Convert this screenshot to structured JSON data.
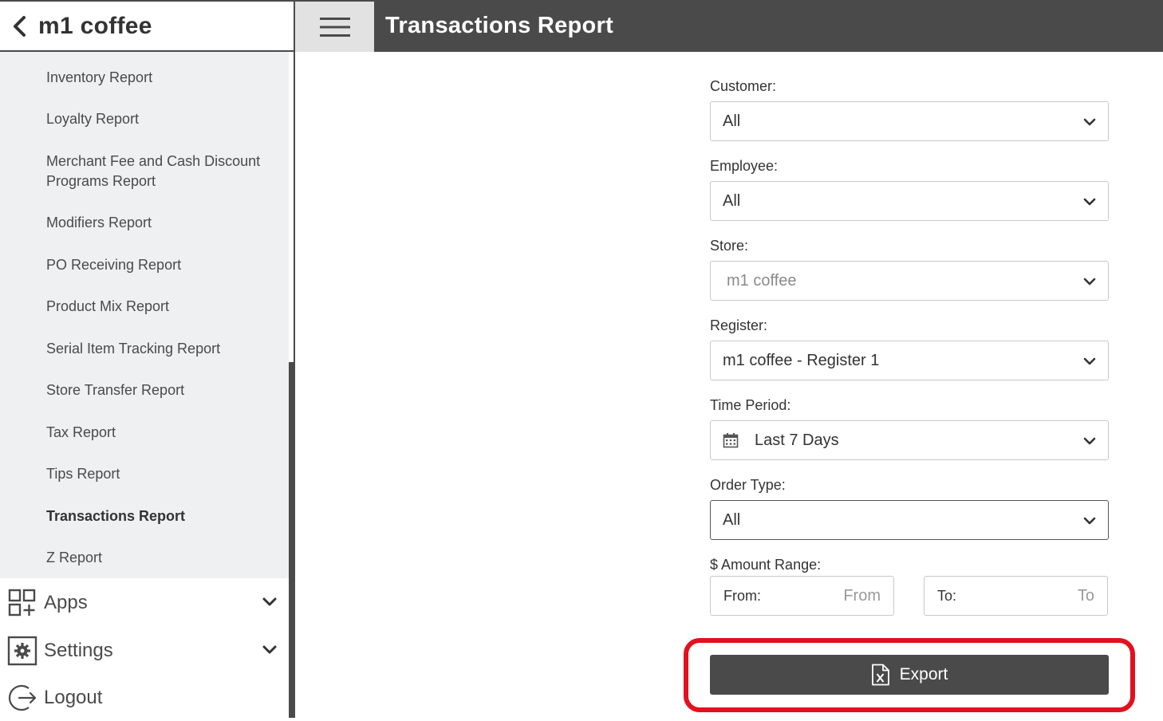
{
  "sidebar": {
    "brand": "m1 coffee",
    "items": [
      {
        "label": "Inventory Report"
      },
      {
        "label": "Loyalty Report"
      },
      {
        "label": "Merchant Fee and Cash Discount Programs Report"
      },
      {
        "label": "Modifiers Report"
      },
      {
        "label": "PO Receiving Report"
      },
      {
        "label": "Product Mix Report"
      },
      {
        "label": "Serial Item Tracking Report"
      },
      {
        "label": "Store Transfer Report"
      },
      {
        "label": "Tax Report"
      },
      {
        "label": "Tips Report"
      },
      {
        "label": "Transactions Report",
        "active": true
      },
      {
        "label": "Z Report"
      }
    ],
    "apps_label": "Apps",
    "settings_label": "Settings",
    "logout_label": "Logout"
  },
  "header": {
    "title": "Transactions Report"
  },
  "form": {
    "customer": {
      "label": "Customer:",
      "value": "All"
    },
    "employee": {
      "label": "Employee:",
      "value": "All"
    },
    "store": {
      "label": "Store:",
      "value": "m1 coffee"
    },
    "register": {
      "label": "Register:",
      "value": "m1 coffee - Register 1"
    },
    "time_period": {
      "label": "Time Period:",
      "value": "Last 7 Days"
    },
    "order_type": {
      "label": "Order Type:",
      "value": "All"
    },
    "amount_range": {
      "label": "$ Amount Range:",
      "from_label": "From:",
      "from_placeholder": "From",
      "to_label": "To:",
      "to_placeholder": "To"
    },
    "export_label": "Export"
  },
  "colors": {
    "dark": "#4a4a4a",
    "sidebar_bg": "#eff0f2",
    "highlight": "#e3101e"
  }
}
